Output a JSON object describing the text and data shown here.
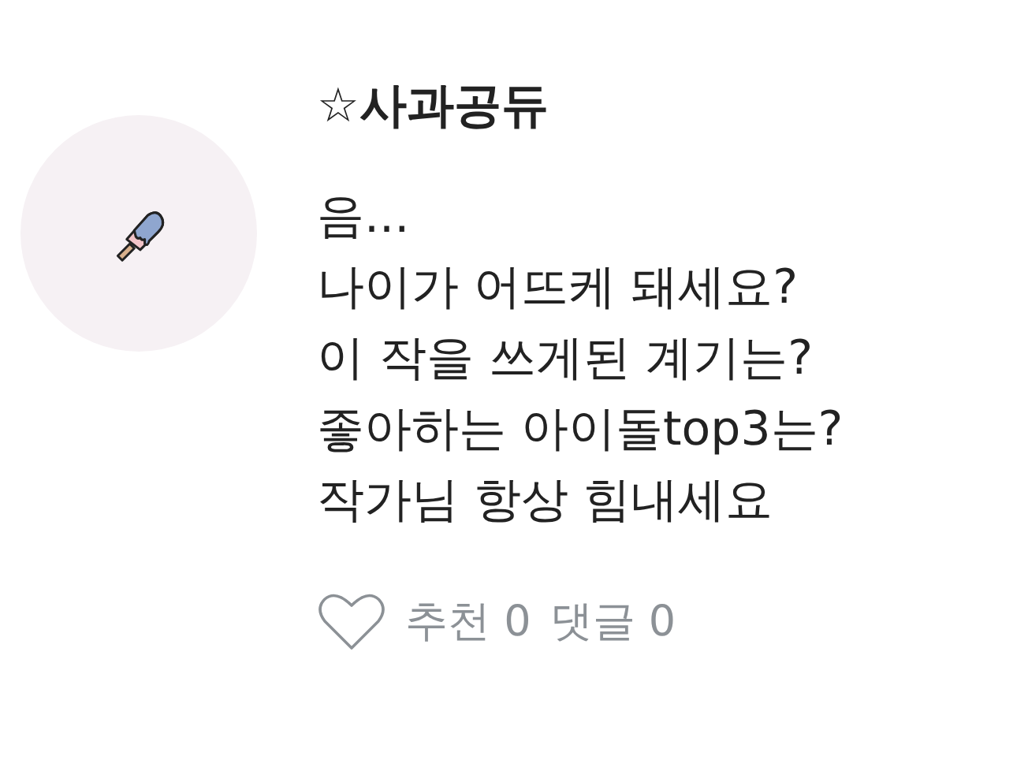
{
  "comment": {
    "author": "☆사과공듀",
    "lines": [
      "음...",
      "나이가 어뜨케 돼세요?",
      "이 작을 쓰게된 계기는?",
      "좋아하는 아이돌top3는?",
      "작가님 항상 힘내세요"
    ],
    "liked": false,
    "stats": [
      {
        "text": "추천 0"
      },
      {
        "text": "댓글 0"
      }
    ]
  }
}
